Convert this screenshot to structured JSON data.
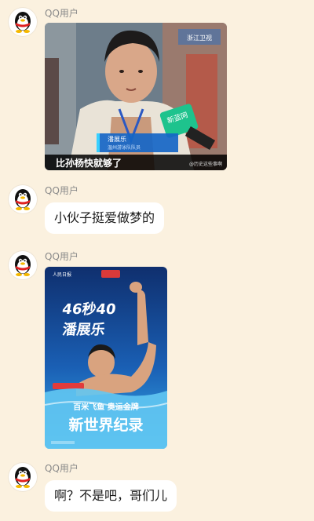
{
  "messages": [
    {
      "sender": "QQ用户",
      "type": "image",
      "image": {
        "subject": "interview-photo",
        "caption": "比孙杨快就够了",
        "nameplate_name": "潘展乐",
        "nameplate_sub": "温州游泳队队员",
        "mic_logo": "新蓝网",
        "watermark": "@历史这些事啊",
        "station_logo": "浙江卫视"
      }
    },
    {
      "sender": "QQ用户",
      "type": "text",
      "text": "小伙子挺爱做梦的"
    },
    {
      "sender": "QQ用户",
      "type": "image",
      "image": {
        "subject": "olympic-record-poster",
        "headline_time": "46秒40",
        "headline_name": "潘展乐",
        "tagline": "百米飞鱼 奥运金牌",
        "record_text": "新世界纪录",
        "top_logo": "人民日报"
      }
    },
    {
      "sender": "QQ用户",
      "type": "text",
      "text": "啊？不是吧，哥们儿"
    }
  ],
  "colors": {
    "background": "#fbf1df",
    "bubble": "#ffffff",
    "name": "#8a8a8a",
    "text": "#1a1a1a"
  }
}
